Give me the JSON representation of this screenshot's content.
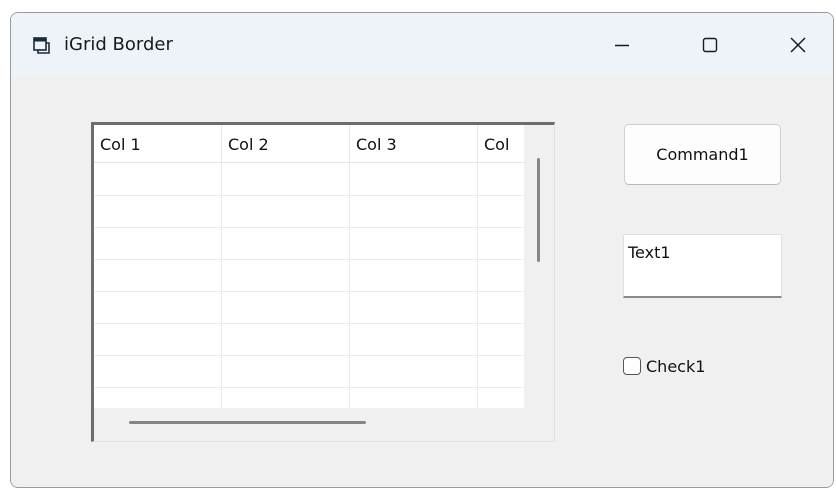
{
  "window": {
    "title": "iGrid Border"
  },
  "grid": {
    "columns": [
      "Col 1",
      "Col 2",
      "Col 3",
      "Col"
    ]
  },
  "command_button": {
    "label": "Command1"
  },
  "textbox": {
    "value": "Text1"
  },
  "checkbox": {
    "label": "Check1",
    "checked": false
  },
  "icons": {
    "app": "form-icon",
    "minimize": "minimize-icon",
    "maximize": "maximize-icon",
    "close": "close-icon"
  }
}
